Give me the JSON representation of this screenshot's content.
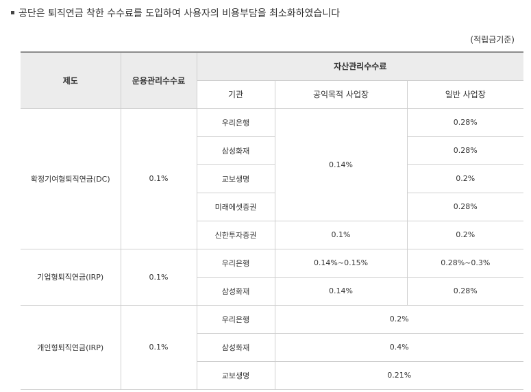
{
  "heading": "공단은 퇴직연금 착한 수수료를 도입하여 사용자의 비용부담을 최소화하였습니다",
  "unit_note": "(적립금기준)",
  "table": {
    "headers": {
      "system": "제도",
      "operation_fee": "운용관리수수료",
      "asset_fee": "자산관리수수료",
      "institution": "기관",
      "public_workplace": "공익목적 사업장",
      "general_workplace": "일반 사업장"
    },
    "groups": [
      {
        "name": "확정기여형퇴직연금(DC)",
        "operation_fee": "0.1%",
        "rows": [
          {
            "institution": "우리은행",
            "general": "0.28%"
          },
          {
            "institution": "삼성화재",
            "general": "0.28%"
          },
          {
            "institution": "교보생명",
            "general": "0.2%"
          },
          {
            "institution": "미래에셋증권",
            "general": "0.28%"
          },
          {
            "institution": "신한투자증권",
            "public": "0.1%",
            "general": "0.2%"
          }
        ],
        "public_shared": "0.14%"
      },
      {
        "name": "기업형퇴직연금(IRP)",
        "operation_fee": "0.1%",
        "rows": [
          {
            "institution": "우리은행",
            "public": "0.14%~0.15%",
            "general": "0.28%~0.3%"
          },
          {
            "institution": "삼성화재",
            "public": "0.14%",
            "general": "0.28%"
          }
        ]
      },
      {
        "name": "개인형퇴직연금(IRP)",
        "operation_fee": "0.1%",
        "rows": [
          {
            "institution": "우리은행",
            "combined": "0.2%"
          },
          {
            "institution": "삼성화재",
            "combined": "0.4%"
          },
          {
            "institution": "교보생명",
            "combined": "0.21%"
          }
        ]
      }
    ]
  }
}
